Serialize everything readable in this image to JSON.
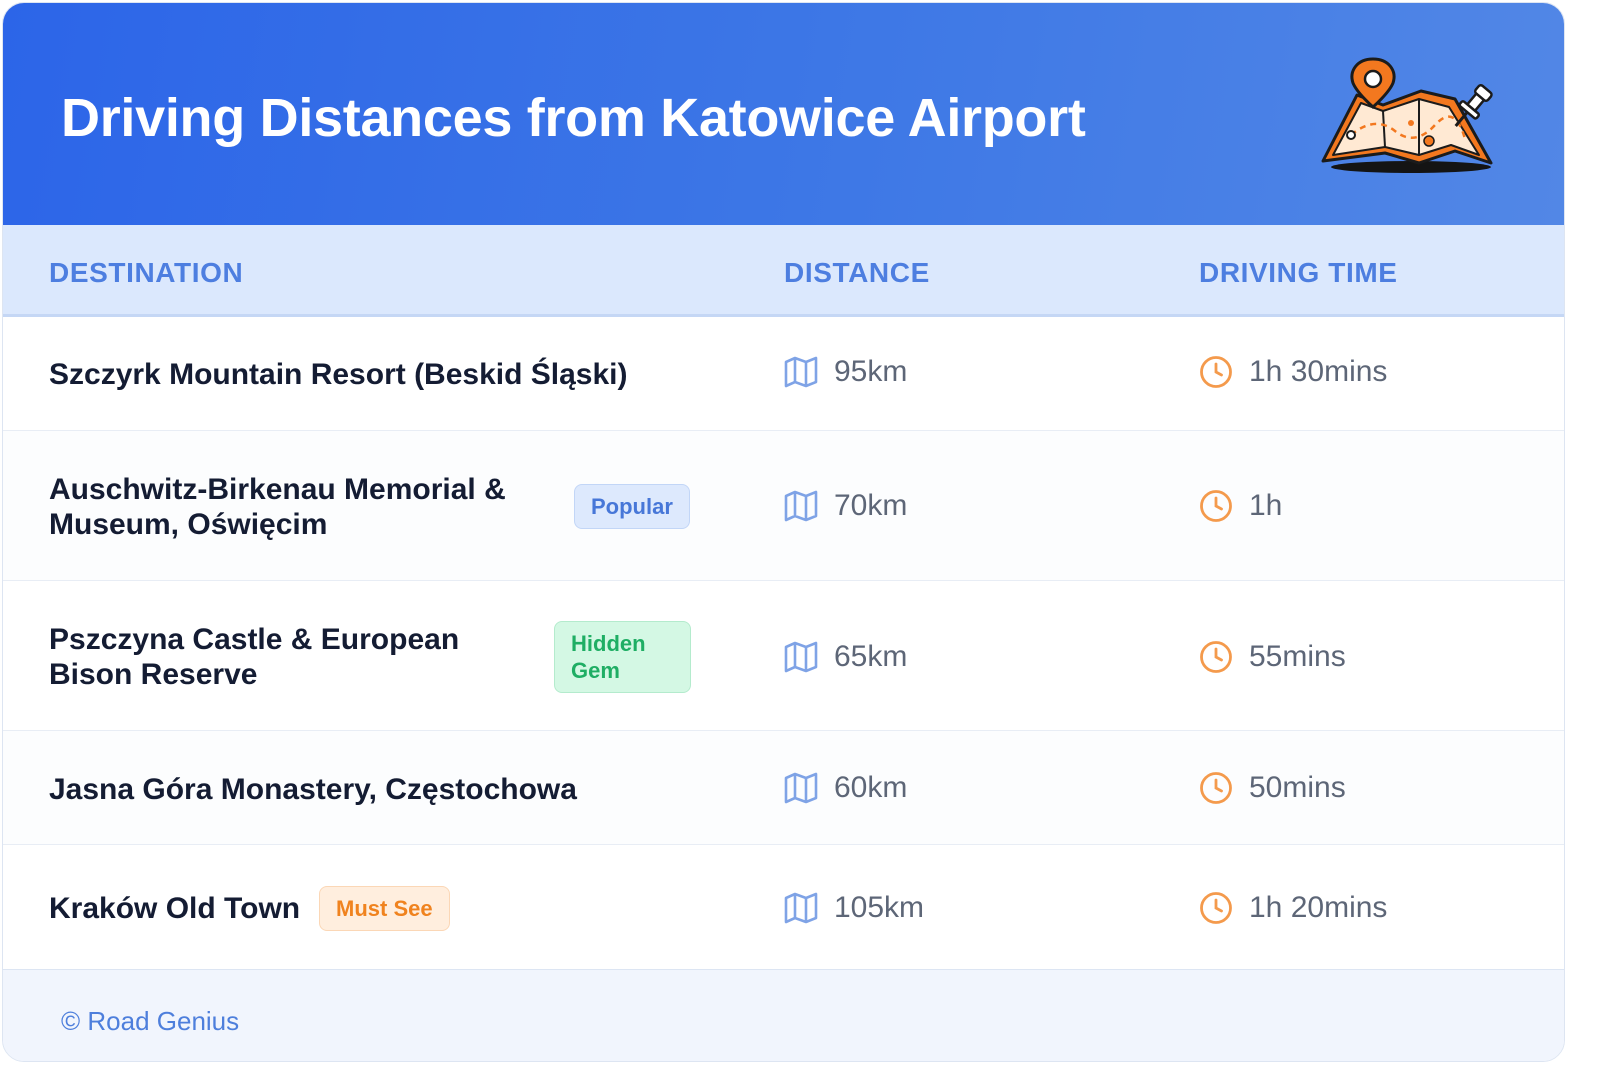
{
  "header": {
    "title": "Driving Distances from Katowice Airport",
    "icon": "map-pin-icon",
    "colors": {
      "gradient_start": "#2c65e8",
      "gradient_end": "#5287e6"
    }
  },
  "columns": {
    "destination": "DESTINATION",
    "distance": "DISTANCE",
    "driving_time": "DRIVING TIME"
  },
  "rows": [
    {
      "destination": "Szczyrk Mountain Resort (Beskid Śląski)",
      "badge": "",
      "distance": "95km",
      "time": "1h 30mins"
    },
    {
      "destination_line1": "Auschwitz-Birkenau Memorial &",
      "destination_line2": "Museum, Oświęcim",
      "badge": "Popular",
      "distance": "70km",
      "time": "1h"
    },
    {
      "destination_line1": "Pszczyna Castle & European",
      "destination_line2": "Bison Reserve",
      "badge_line1": "Hidden",
      "badge_line2": "Gem",
      "distance": "65km",
      "time": "55mins"
    },
    {
      "destination": "Jasna Góra Monastery, Częstochowa",
      "badge": "",
      "distance": "60km",
      "time": "50mins"
    },
    {
      "destination": "Kraków Old Town",
      "badge": "Must See",
      "distance": "105km",
      "time": "1h 20mins"
    }
  ],
  "icons": {
    "distance": "map-icon",
    "time": "clock-icon"
  },
  "badge_colors": {
    "popular": "#4777d8",
    "hidden_gem": "#1fae64",
    "must_see": "#f0831f"
  },
  "footer": {
    "credit": "© Road Genius"
  }
}
